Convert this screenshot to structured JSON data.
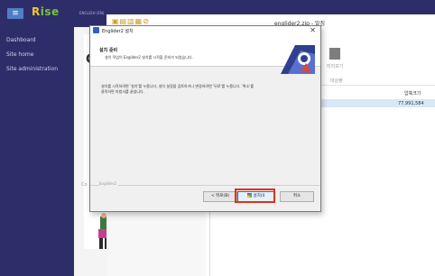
{
  "lms": {
    "menu_icon": "hamburger-icon",
    "brand_part1": "R",
    "brand_part2": "ise",
    "sidebar": [
      {
        "label": "Dashboard"
      },
      {
        "label": "Site home"
      },
      {
        "label": "Site administration"
      }
    ],
    "top_text": "ENGLISH (EN)",
    "big_letter": "C",
    "gray_text": "Co"
  },
  "explorer": {
    "title": "englider2.zip - 알집",
    "quick_access_icons": [
      "folder-icon",
      "save-icon",
      "document-icon",
      "folder-icon",
      "stop-icon"
    ],
    "ribbon_labels": [
      "미리보기",
      "대상폴"
    ],
    "column_header": "압축크기",
    "file_size": "77,991,584"
  },
  "dialog": {
    "title": "Englider2 설치",
    "close_label": "✕",
    "header_title": "설치 준비",
    "header_subtitle": "설치 작업이 Englider2 설치를 시작할 준비가 되었습니다.",
    "body_line1": "설치를 시작하려면 '설치'를 누릅니다.  설치 설정을 검토하거나 변경하려면 '뒤로'를 누릅니다. '취소'를",
    "body_line2": "클릭하면 마법사를 끝냅니다.",
    "brand_text": "Englider2",
    "buttons": {
      "back": "< 뒤로(B)",
      "install": "설치(I)",
      "cancel": "취소"
    }
  },
  "colors": {
    "sidebar_bg": "#2d2e69",
    "highlight": "#e0301e",
    "install_border": "#0078d7"
  }
}
